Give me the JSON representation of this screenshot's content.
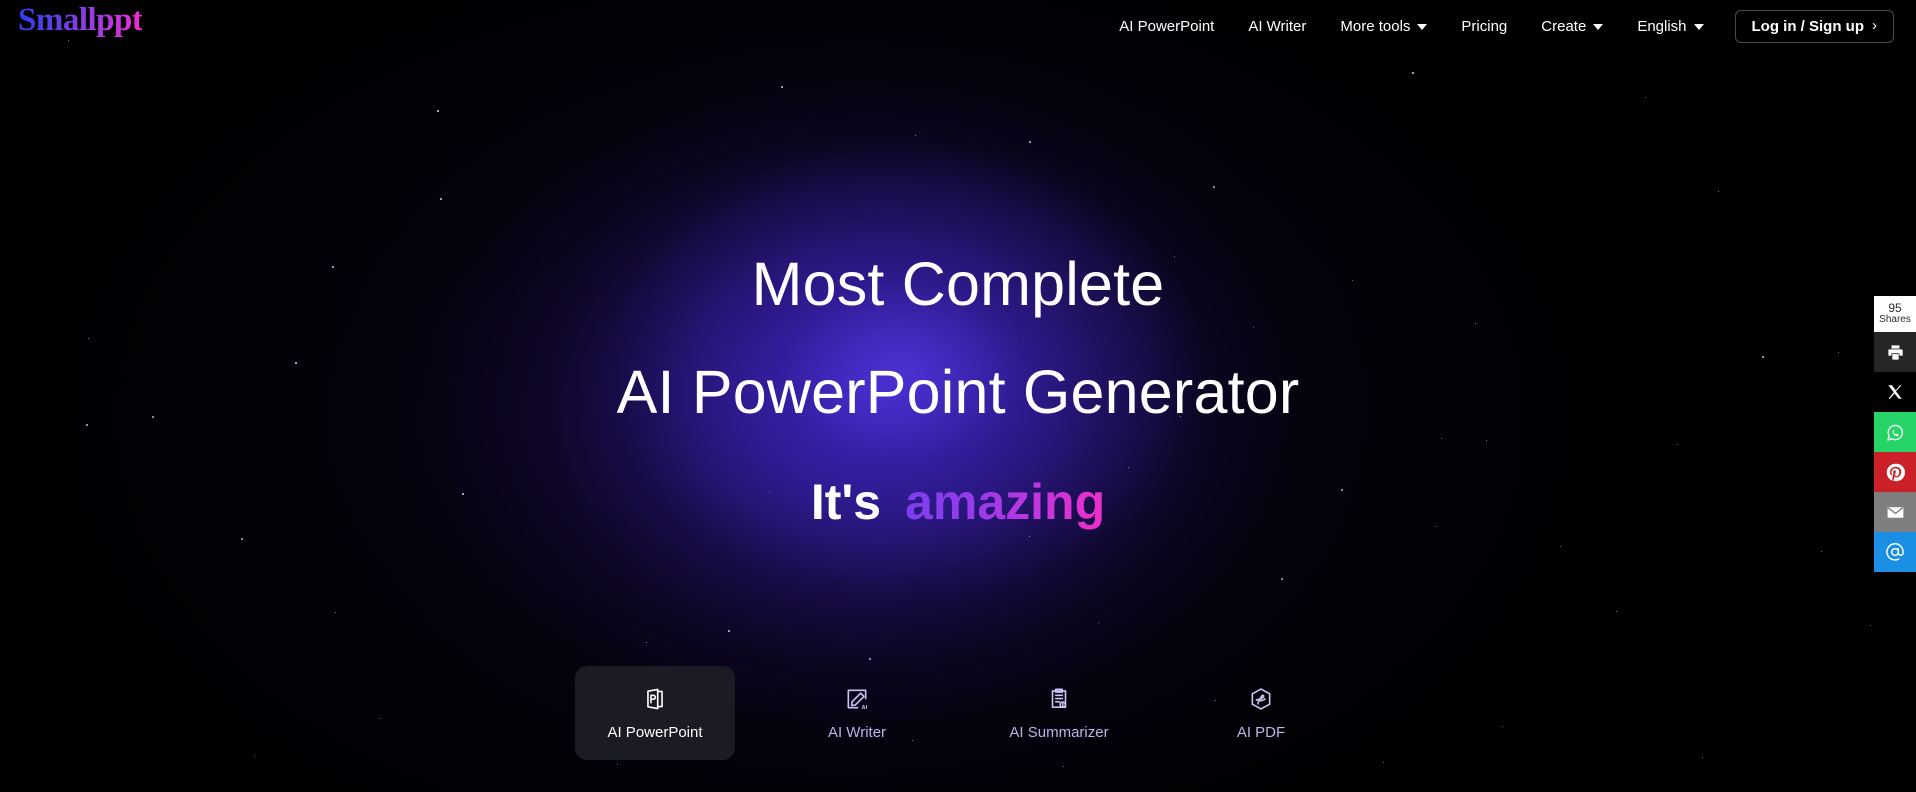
{
  "brand": {
    "logo_text": "Smallppt"
  },
  "nav": {
    "items": [
      {
        "label": "AI PowerPoint",
        "has_caret": false,
        "name": "nav-ai-powerpoint"
      },
      {
        "label": "AI Writer",
        "has_caret": false,
        "name": "nav-ai-writer"
      },
      {
        "label": "More tools",
        "has_caret": true,
        "name": "nav-more-tools"
      },
      {
        "label": "Pricing",
        "has_caret": false,
        "name": "nav-pricing"
      },
      {
        "label": "Create",
        "has_caret": true,
        "name": "nav-create"
      },
      {
        "label": "English",
        "has_caret": true,
        "name": "nav-language"
      }
    ],
    "login_label": "Log in / Sign up",
    "login_chevron": "›"
  },
  "hero": {
    "line1": "Most Complete",
    "line2": "AI PowerPoint Generator",
    "line3_prefix": "It's",
    "line3_highlight": "amazing"
  },
  "tools": [
    {
      "label": "AI PowerPoint",
      "icon": "powerpoint-icon",
      "active": true
    },
    {
      "label": "AI Writer",
      "icon": "pencil-ai-icon",
      "active": false
    },
    {
      "label": "AI Summarizer",
      "icon": "clipboard-list-icon",
      "active": false
    },
    {
      "label": "AI PDF",
      "icon": "pdf-hexagon-icon",
      "active": false
    }
  ],
  "share": {
    "count": "95",
    "count_label": "Shares",
    "buttons": [
      {
        "name": "share-print-button",
        "icon": "printer-icon",
        "color": "#262626"
      },
      {
        "name": "share-x-button",
        "icon": "x-twitter-icon",
        "color": "#000000"
      },
      {
        "name": "share-whatsapp-button",
        "icon": "whatsapp-icon",
        "color": "#25d366"
      },
      {
        "name": "share-pinterest-button",
        "icon": "pinterest-icon",
        "color": "#cb2027"
      },
      {
        "name": "share-email-button",
        "icon": "envelope-icon",
        "color": "#7f7f7f"
      },
      {
        "name": "share-more-button",
        "icon": "at-sign-icon",
        "color": "#1a8fe3"
      }
    ]
  },
  "theme": {
    "background": "#000000",
    "glow_core": "#3e26be",
    "accent_purple": "#7b3ff0",
    "accent_pink": "#f02fc8",
    "tool_label": "#b9b6e8",
    "card_bg": "#1b1b24"
  }
}
